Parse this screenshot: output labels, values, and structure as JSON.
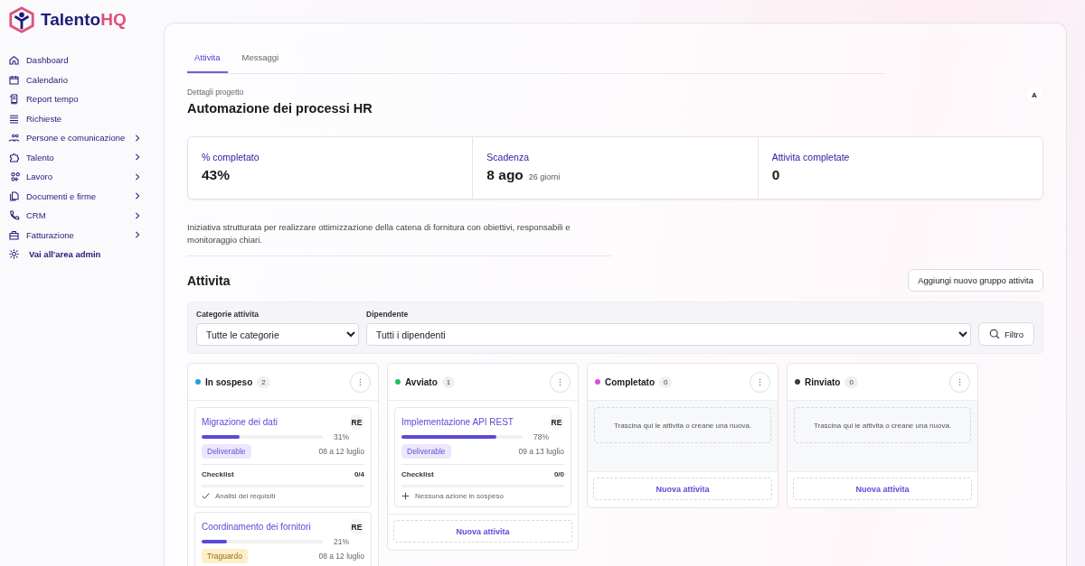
{
  "brand": {
    "name": "Talento",
    "accent": "HQ"
  },
  "sidebar": {
    "items": [
      {
        "label": "Dashboard",
        "expandable": false
      },
      {
        "label": "Calendario",
        "expandable": false
      },
      {
        "label": "Report tempo",
        "expandable": false
      },
      {
        "label": "Richieste",
        "expandable": false
      },
      {
        "label": "Persone e comunicazione",
        "expandable": true
      },
      {
        "label": "Talento",
        "expandable": true
      },
      {
        "label": "Lavoro",
        "expandable": true
      },
      {
        "label": "Documenti e firme",
        "expandable": true
      },
      {
        "label": "CRM",
        "expandable": true
      },
      {
        "label": "Fatturazione",
        "expandable": true
      },
      {
        "label": "Vai all'area admin",
        "expandable": false
      }
    ]
  },
  "tabs": [
    {
      "label": "Attivita",
      "selected": true
    },
    {
      "label": "Messaggi",
      "selected": false
    }
  ],
  "project": {
    "caption": "Dettagli progetto",
    "title": "Automazione dei processi HR",
    "avatar": "A",
    "stats": [
      {
        "label": "% completato",
        "value": "43%"
      },
      {
        "label": "Scadenza",
        "value": "8 ago",
        "note": "26 giorni"
      },
      {
        "label": "Attivita completate",
        "value": "0"
      }
    ],
    "description": "Iniziativa strutturata per realizzare ottimizzazione della catena di fornitura con obiettivi, responsabili e monitoraggio chiari."
  },
  "activities": {
    "title": "Attivita",
    "add_button": "Aggiungi nuovo gruppo attivita",
    "filters": [
      {
        "label": "Categorie attivita",
        "value": "Tutte le categorie"
      },
      {
        "label": "Dipendente",
        "value": "Tutti i dipendenti"
      }
    ],
    "filter_button": "Filtro",
    "columns": [
      {
        "name": "In sospeso",
        "count": "2",
        "color": "#1ea0e0",
        "tasks": [
          {
            "title": "Migrazione dei dati",
            "assignee": "RE",
            "level": 0.31,
            "percent": "31%",
            "tag": {
              "label": "Deliverable",
              "color": "#ece7fd"
            },
            "dates": "08 a 12 luglio",
            "checklist_label": "Checklist",
            "checklist_count": "0/4",
            "item": {
              "kind": "check",
              "text": "Analisi dei requisiti"
            }
          },
          {
            "title": "Coordinamento dei fornitori",
            "assignee": "RE",
            "level": 0.21,
            "percent": "21%",
            "tag": {
              "label": "Traguardo",
              "color": "#fdefc8"
            },
            "dates": "08 a 12 luglio"
          }
        ]
      },
      {
        "name": "Avviato",
        "count": "1",
        "color": "#1fc15a",
        "tasks": [
          {
            "title": "Implementazione API REST",
            "assignee": "RE",
            "level": 0.78,
            "percent": "78%",
            "tag": {
              "label": "Deliverable",
              "color": "#ece7fd"
            },
            "dates": "09 a 13 luglio",
            "checklist_label": "Checklist",
            "checklist_count": "0/0",
            "item": {
              "kind": "add",
              "text": "Nessuna azione in sospeso"
            }
          }
        ],
        "new_button": "Nuova attivita"
      },
      {
        "name": "Completato",
        "count": "0",
        "color": "#d94fe0",
        "empty": "Trascina qui le attivita o creane una nuova.",
        "new_button": "Nuova attivita"
      },
      {
        "name": "Rinviato",
        "count": "0",
        "color": "#3a3a3a",
        "empty": "Trascina qui le attivita o creane una nuova.",
        "new_button": "Nuova attivita"
      }
    ]
  }
}
